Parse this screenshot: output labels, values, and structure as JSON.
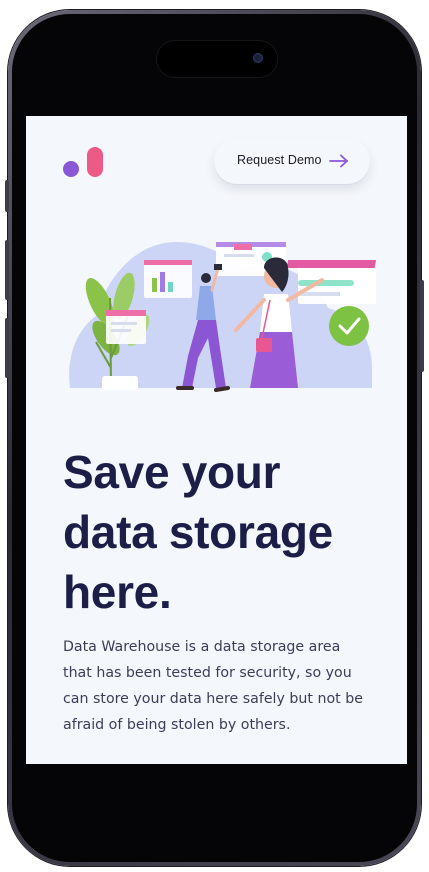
{
  "header": {
    "demo_button_label": "Request Demo",
    "demo_button_icon": "arrow-right-icon"
  },
  "hero": {
    "headline_lines": [
      "Save your",
      "data storage",
      "here."
    ],
    "description_lines": [
      "Data Warehouse is a data storage area",
      "that has been tested for security, so you",
      "can store your data here safely but not be",
      "afraid of being stolen by others."
    ]
  },
  "colors": {
    "accent_purple": "#8a57d6",
    "accent_pink": "#ee5a86",
    "headline": "#1c1e48",
    "screen_bg": "#f4f7fb",
    "check_green": "#7dc242"
  }
}
